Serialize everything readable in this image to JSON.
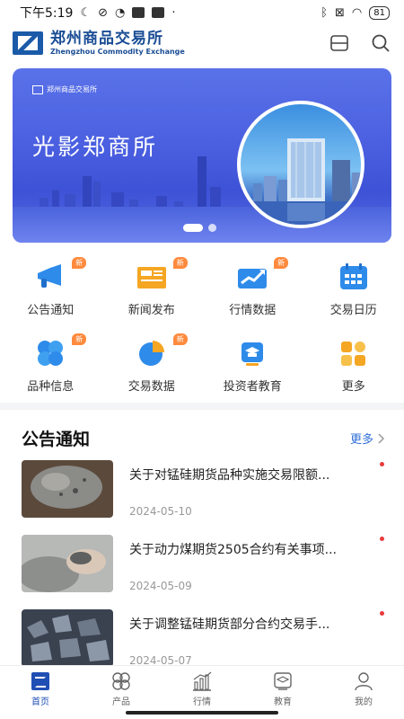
{
  "status_bar": {
    "time": "下午5:19",
    "battery": "81"
  },
  "header": {
    "logo_cn": "郑州商品交易所",
    "logo_en": "Zhengzhou Commodity Exchange"
  },
  "banner": {
    "logo_text": "郑州商品交易所",
    "title": "光影郑商所"
  },
  "grid": [
    {
      "label": "公告通知",
      "icon": "megaphone-icon",
      "is_new": true
    },
    {
      "label": "新闻发布",
      "icon": "newspaper-icon",
      "is_new": true
    },
    {
      "label": "行情数据",
      "icon": "chart-trend-icon",
      "is_new": true
    },
    {
      "label": "交易日历",
      "icon": "calendar-icon",
      "is_new": false
    },
    {
      "label": "品种信息",
      "icon": "clover-icon",
      "is_new": true
    },
    {
      "label": "交易数据",
      "icon": "pie-chart-icon",
      "is_new": true
    },
    {
      "label": "投资者教育",
      "icon": "graduation-icon",
      "is_new": false
    },
    {
      "label": "更多",
      "icon": "more-grid-icon",
      "is_new": false
    }
  ],
  "badge_new": "新",
  "section": {
    "title": "公告通知",
    "more": "更多"
  },
  "news": [
    {
      "title": "关于对锰硅期货品种实施交易限额...",
      "date": "2024-05-10",
      "thumb": "ore-rock"
    },
    {
      "title": "关于动力煤期货2505合约有关事项...",
      "date": "2024-05-09",
      "thumb": "coal-hand"
    },
    {
      "title": "关于调整锰硅期货部分合约交易手...",
      "date": "2024-05-07",
      "thumb": "silicon-pile"
    }
  ],
  "tabs": [
    {
      "label": "首页",
      "active": true
    },
    {
      "label": "产品",
      "active": false
    },
    {
      "label": "行情",
      "active": false
    },
    {
      "label": "教育",
      "active": false
    },
    {
      "label": "我的",
      "active": false
    }
  ],
  "colors": {
    "brand": "#1a4d95",
    "accent": "#2f6fd6",
    "badge": "#ff8a3d",
    "unread": "#e83b3b"
  }
}
